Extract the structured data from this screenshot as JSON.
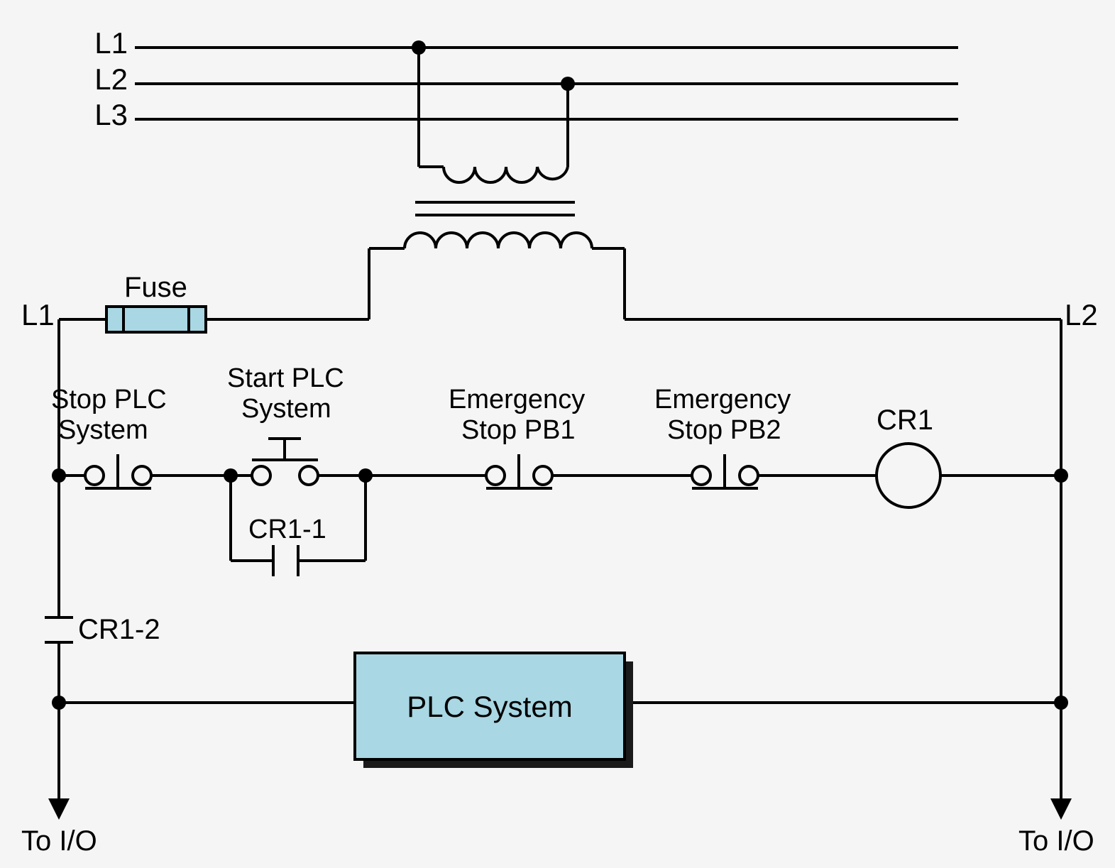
{
  "lines": {
    "L1_supply": "L1",
    "L2_supply": "L2",
    "L3_supply": "L3",
    "L1_control": "L1",
    "L2_control": "L2"
  },
  "components": {
    "fuse": "Fuse",
    "stop_plc_line1": "Stop PLC",
    "stop_plc_line2": "System",
    "start_plc_line1": "Start PLC",
    "start_plc_line2": "System",
    "estop1_line1": "Emergency",
    "estop1_line2": "Stop PB1",
    "estop2_line1": "Emergency",
    "estop2_line2": "Stop PB2",
    "cr1": "CR1",
    "cr1_1": "CR1-1",
    "cr1_2": "CR1-2",
    "plc_box": "PLC System"
  },
  "outputs": {
    "to_io_left": "To I/O",
    "to_io_right": "To I/O"
  }
}
